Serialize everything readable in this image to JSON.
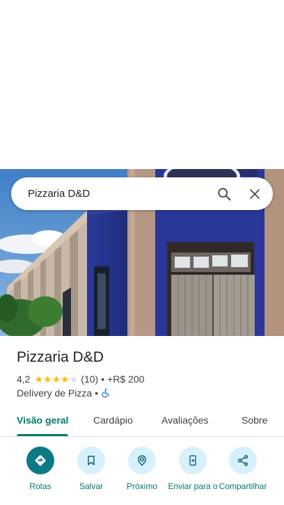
{
  "search": {
    "query": "Pizzaria D&D"
  },
  "place": {
    "name": "Pizzaria D&D",
    "rating": "4,2",
    "rating_value": 4.2,
    "reviews": "(10)",
    "price_sep": "•",
    "price": "+R$ 200",
    "category": "Delivery de Pizza",
    "category_sep": "•",
    "accessibility_icon": "wheelchair-icon"
  },
  "tabs": [
    {
      "label": "Visão geral",
      "active": true
    },
    {
      "label": "Cardápio",
      "active": false
    },
    {
      "label": "Avaliações",
      "active": false
    },
    {
      "label": "Sobre",
      "active": false
    }
  ],
  "actions": [
    {
      "label": "Rotas",
      "icon": "directions-icon"
    },
    {
      "label": "Salvar",
      "icon": "bookmark-icon"
    },
    {
      "label": "Próximo",
      "icon": "nearby-icon"
    },
    {
      "label": "Enviar para o",
      "icon": "send-to-phone-icon"
    },
    {
      "label": "Compartilhar",
      "icon": "share-icon"
    }
  ],
  "colors": {
    "accent": "#00796b",
    "primary_button": "#0b7a84",
    "action_bg": "#d7f1fc",
    "star": "#fbbc04"
  }
}
